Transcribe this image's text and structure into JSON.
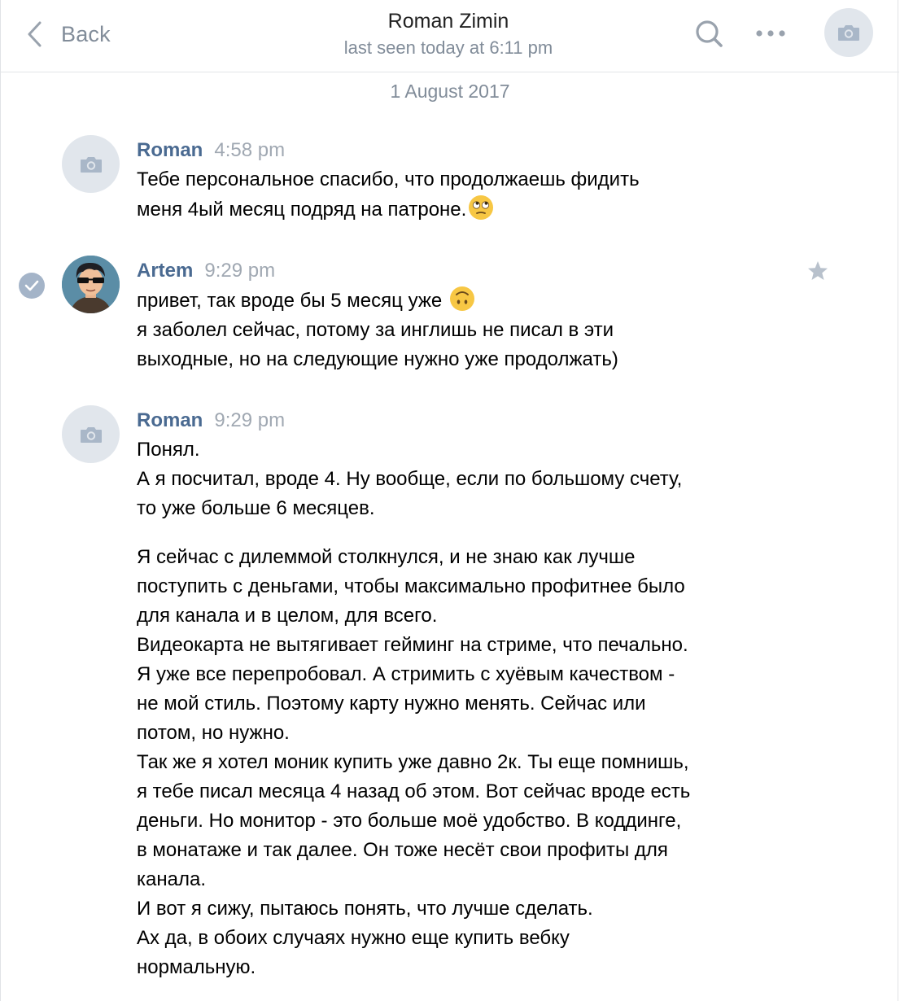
{
  "header": {
    "back_label": "Back",
    "title": "Roman Zimin",
    "subtitle": "last seen today at 6:11 pm"
  },
  "date_separator": "1 August 2017",
  "messages": [
    {
      "author": "Roman",
      "time": "4:58 pm",
      "avatar": "camera-placeholder",
      "lines": [
        "Тебе персональное спасибо, что продолжаешь фидить",
        "меня 4ый месяц подряд на патроне."
      ],
      "emoji": "face-with-rolling-eyes"
    },
    {
      "author": "Artem",
      "time": "9:29 pm",
      "avatar": "cartoon-man-with-sunglasses",
      "selected": true,
      "lines": [
        "привет, так вроде бы 5 месяц уже",
        "я заболел сейчас, потому за инглишь не писал в эти",
        "выходные, но на следующие нужно уже продолжать)"
      ],
      "emoji": "upside-down-face"
    },
    {
      "author": "Roman",
      "time": "9:29 pm",
      "avatar": "camera-placeholder",
      "paragraph1": [
        "Понял.",
        "А я посчитал, вроде 4. Ну вообще, если по большому счету,",
        "то уже больше 6 месяцев."
      ],
      "paragraph2": [
        "Я сейчас с дилеммой столкнулся, и не знаю как лучше",
        "поступить с деньгами, чтобы максимально профитнее было",
        "для канала и в целом, для всего.",
        "Видеокарта не вытягивает гейминг на стриме, что печально.",
        "Я уже все перепробовал. А стримить с хуёвым качеством -",
        "не мой стиль. Поэтому карту нужно менять. Сейчас или",
        "потом, но нужно.",
        "Так же я хотел моник купить уже давно 2к. Ты еще помнишь,",
        "я тебе писал месяца 4 назад об этом. Вот сейчас вроде есть",
        "деньги. Но монитор - это больше моё удобство. В коддинге,",
        "в монатаже и так далее. Он тоже несёт свои профиты для",
        "канала.",
        "И вот я сижу, пытаюсь понять, что лучше сделать.",
        "Ах да, в обоих случаях нужно еще купить вебку",
        "нормальную."
      ]
    }
  ],
  "colors": {
    "author": "#4a6a91",
    "meta": "#818c99",
    "avatar_bg": "#e1e6ec",
    "check_bg": "#a4b4c8"
  },
  "icons": [
    "chevron-left-icon",
    "search-icon",
    "more-icon",
    "camera-icon",
    "check-icon",
    "star-icon"
  ]
}
